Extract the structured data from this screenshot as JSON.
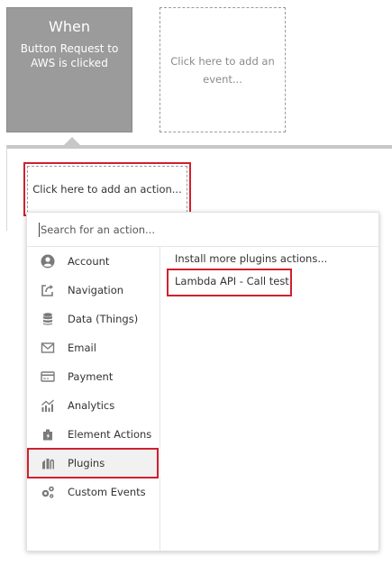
{
  "event": {
    "when_label": "When",
    "description": "Button Request to AWS is clicked"
  },
  "add_event": {
    "label": "Click here to add an event..."
  },
  "add_action": {
    "label": "Click here to add an action..."
  },
  "search": {
    "placeholder": "Search for an action..."
  },
  "categories": [
    {
      "label": "Account",
      "icon": "account-icon"
    },
    {
      "label": "Navigation",
      "icon": "navigation-icon"
    },
    {
      "label": "Data (Things)",
      "icon": "database-icon"
    },
    {
      "label": "Email",
      "icon": "email-icon"
    },
    {
      "label": "Payment",
      "icon": "payment-icon"
    },
    {
      "label": "Analytics",
      "icon": "analytics-icon"
    },
    {
      "label": "Element Actions",
      "icon": "element-actions-icon"
    },
    {
      "label": "Plugins",
      "icon": "plugins-icon"
    },
    {
      "label": "Custom Events",
      "icon": "custom-events-icon"
    }
  ],
  "plugin_actions": [
    {
      "label": "Install more plugins actions..."
    },
    {
      "label": "Lambda API - Call test"
    }
  ],
  "colors": {
    "event_card_bg": "#9b9b9b",
    "highlight": "#d0202e",
    "icon": "#7a7a7a"
  }
}
